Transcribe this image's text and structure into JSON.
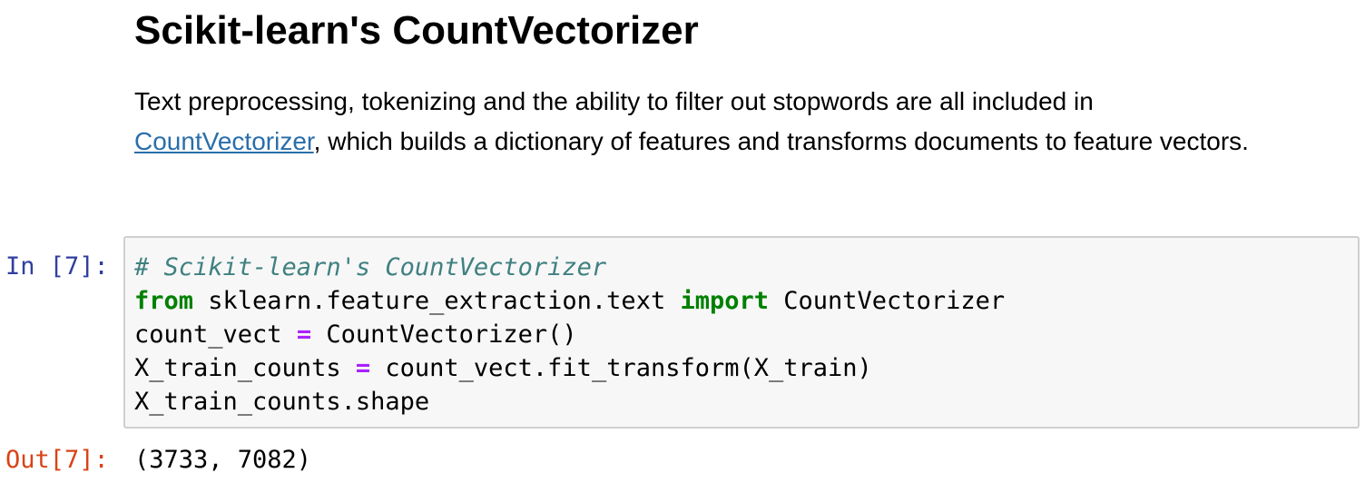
{
  "markdown": {
    "title": "Scikit-learn's CountVectorizer",
    "paragraph_before_link": "Text preprocessing, tokenizing and the ability to filter out stopwords are all included in ",
    "link_text": "CountVectorizer",
    "paragraph_after_link": ", which builds a dictionary of features and transforms documents to feature vectors."
  },
  "code_cell": {
    "prompt_in": "In [7]:",
    "line1_comment": "# Scikit-learn's CountVectorizer",
    "line2_kw_from": "from",
    "line2_module": " sklearn.feature_extraction.text ",
    "line2_kw_import": "import",
    "line2_name": " CountVectorizer",
    "line3_lhs": "count_vect ",
    "line3_op": "=",
    "line3_rhs": " CountVectorizer()",
    "line4_lhs": "X_train_counts ",
    "line4_op": "=",
    "line4_rhs": " count_vect.fit_transform(X_train)",
    "line5": "X_train_counts.shape"
  },
  "output_cell": {
    "prompt_out": "Out[7]:",
    "value": "(3733, 7082)"
  },
  "colors": {
    "prompt_in": "#303f9f",
    "prompt_out": "#d84315",
    "link": "#296eaa",
    "keyword": "#008000",
    "comment": "#408080",
    "operator": "#aa22ff"
  }
}
